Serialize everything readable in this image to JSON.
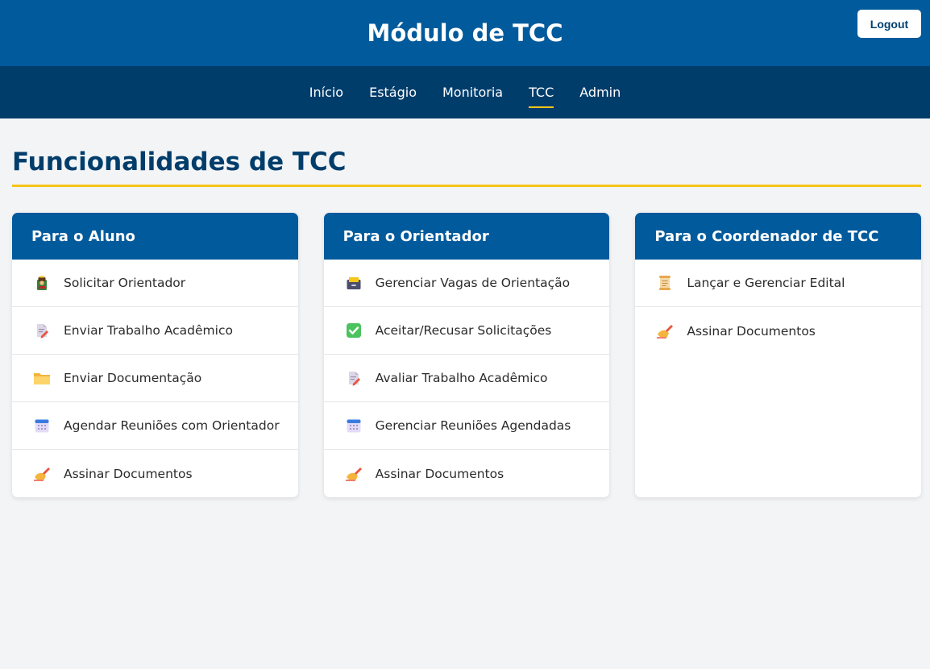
{
  "header": {
    "title": "Módulo de TCC",
    "logout_label": "Logout"
  },
  "nav": {
    "items": [
      {
        "label": "Início"
      },
      {
        "label": "Estágio"
      },
      {
        "label": "Monitoria"
      },
      {
        "label": "TCC"
      },
      {
        "label": "Admin"
      }
    ],
    "active": "TCC"
  },
  "main": {
    "title": "Funcionalidades de TCC",
    "cards": [
      {
        "title": "Para o Aluno",
        "items": [
          {
            "label": "Solicitar Orientador",
            "icon": "student-icon"
          },
          {
            "label": "Enviar Trabalho Acadêmico",
            "icon": "document-edit-icon"
          },
          {
            "label": "Enviar Documentação",
            "icon": "folder-icon"
          },
          {
            "label": "Agendar Reuniões com Orientador",
            "icon": "calendar-icon"
          },
          {
            "label": "Assinar Documentos",
            "icon": "writing-hand-icon"
          }
        ]
      },
      {
        "title": "Para o Orientador",
        "items": [
          {
            "label": "Gerenciar Vagas de Orientação",
            "icon": "card-index-box-icon"
          },
          {
            "label": "Aceitar/Recusar Solicitações",
            "icon": "check-mark-icon"
          },
          {
            "label": "Avaliar Trabalho Acadêmico",
            "icon": "document-edit-icon"
          },
          {
            "label": "Gerenciar Reuniões Agendadas",
            "icon": "calendar-icon"
          },
          {
            "label": "Assinar Documentos",
            "icon": "writing-hand-icon"
          }
        ]
      },
      {
        "title": "Para o Coordenador de TCC",
        "items": [
          {
            "label": "Lançar e Gerenciar Edital",
            "icon": "scroll-icon"
          },
          {
            "label": "Assinar Documentos",
            "icon": "writing-hand-icon"
          }
        ]
      }
    ]
  },
  "colors": {
    "header_bg": "#005a9c",
    "nav_bg": "#003d6b",
    "accent": "#f5c518",
    "page_bg": "#f3f4f6"
  }
}
